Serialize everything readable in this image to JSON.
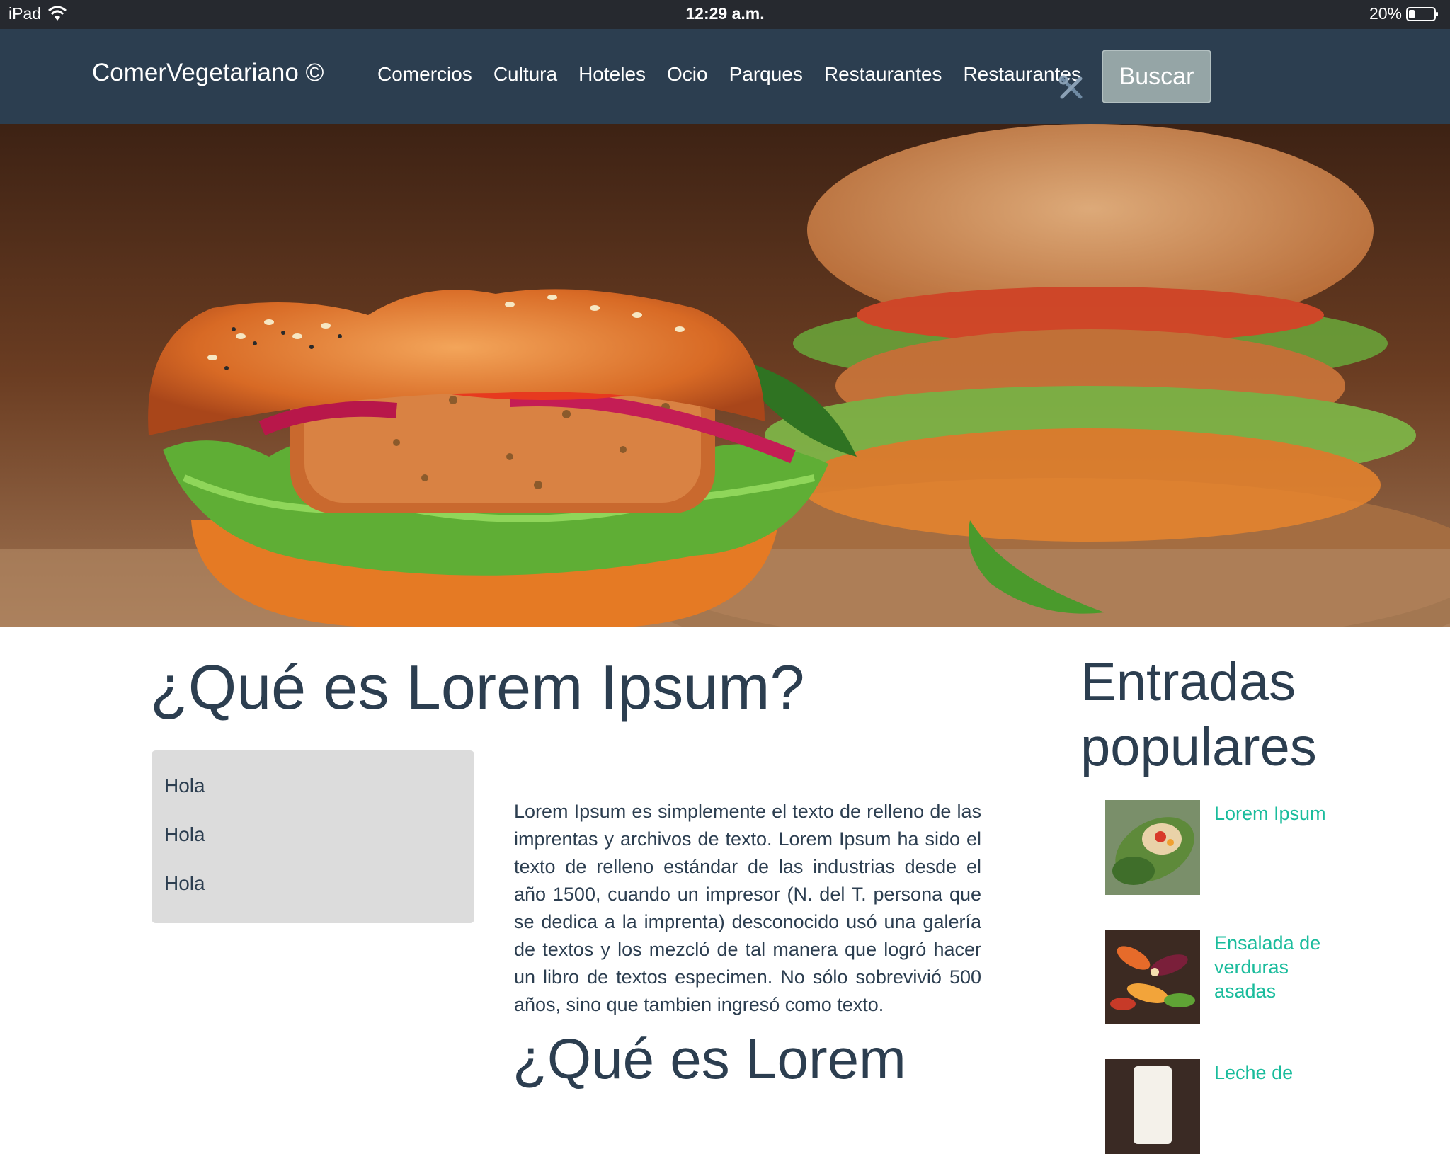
{
  "status_bar": {
    "device": "iPad",
    "time": "12:29 a.m.",
    "battery": "20%"
  },
  "navbar": {
    "brand": "ComerVegetariano ©",
    "links": [
      "Comercios",
      "Cultura",
      "Hoteles",
      "Ocio",
      "Parques",
      "Restaurantes",
      "Restaurantes"
    ],
    "search_label": "Buscar"
  },
  "main": {
    "title": "¿Qué es Lorem Ipsum?",
    "hola_items": [
      "Hola",
      "Hola",
      "Hola"
    ],
    "body": "Lorem Ipsum es simplemente el texto de relleno de las imprentas y archivos de texto. Lorem Ipsum ha sido el texto de relleno estándar de las industrias desde el año 1500, cuando un impresor (N. del T. persona que se dedica a la imprenta) desconocido usó una galería de textos y los mezcló de tal manera que logró hacer un libro de textos especimen. No sólo sobrevivió 500 años, sino que tambien ingresó como texto.",
    "second_title": "¿Qué es Lorem"
  },
  "sidebar": {
    "title": "Entradas populares",
    "entries": [
      {
        "label": "Lorem Ipsum"
      },
      {
        "label": "Ensalada de verduras asadas"
      },
      {
        "label": "Leche de"
      }
    ]
  },
  "colors": {
    "navbar": "#2c3e50",
    "status_bar": "#26292f",
    "search_button": "#95a5a6",
    "link_accent": "#1abc9c",
    "heading": "#2c3e50",
    "hola_box": "#dcdcdc"
  }
}
